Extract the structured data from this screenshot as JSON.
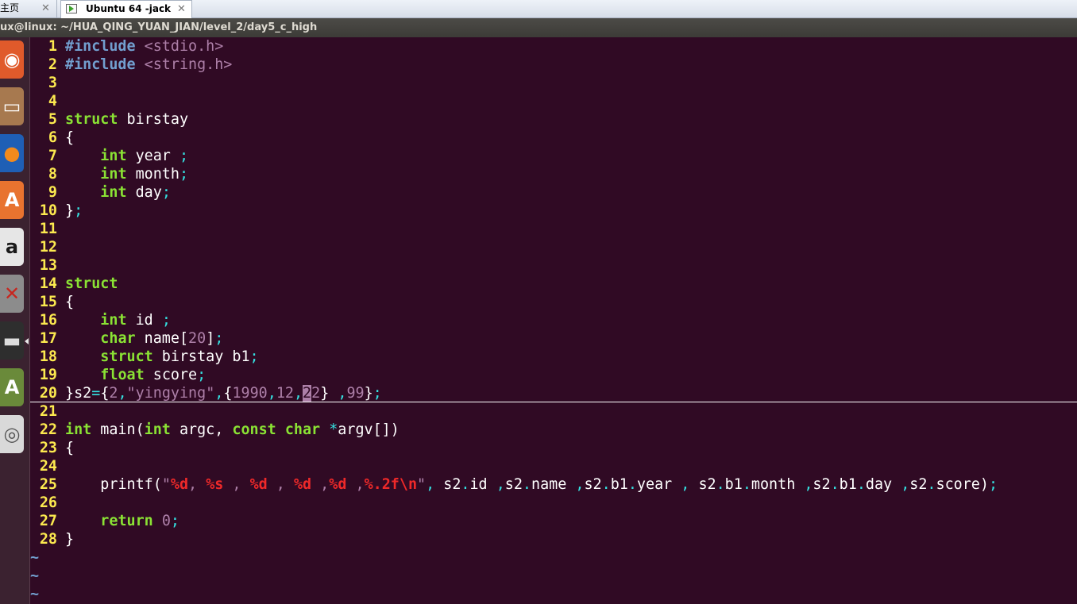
{
  "tabs": {
    "home_label": "主页",
    "vm_label": "Ubuntu 64 -jack",
    "close_glyph": "✕"
  },
  "window": {
    "title": "ux@linux: ~/HUA_QING_YUAN_JIAN/level_2/day5_c_high"
  },
  "launcher": {
    "items": [
      {
        "name": "ubuntu-dash-icon",
        "glyph": "◉",
        "bg": "#e05a2b",
        "fg": "#ffffff"
      },
      {
        "name": "files-icon",
        "glyph": "▭",
        "bg": "#a7794f",
        "fg": "#ffffff"
      },
      {
        "name": "firefox-icon",
        "glyph": "●",
        "bg": "#1f5fb5",
        "fg": "#f28a1c"
      },
      {
        "name": "software-center-icon",
        "glyph": "A",
        "bg": "#e8732f",
        "fg": "#ffffff"
      },
      {
        "name": "amazon-icon",
        "glyph": "a",
        "bg": "#e6e6e6",
        "fg": "#1a1a1a"
      },
      {
        "name": "system-settings-icon",
        "glyph": "✕",
        "bg": "#8c8c8c",
        "fg": "#c7261f"
      },
      {
        "name": "terminal-icon",
        "glyph": "▬",
        "bg": "#2e2e2e",
        "fg": "#dddddd"
      },
      {
        "name": "software-updater-icon",
        "glyph": "A",
        "bg": "#6a8a3a",
        "fg": "#ffffff"
      },
      {
        "name": "dvd-icon",
        "glyph": "◎",
        "bg": "#d9d9d9",
        "fg": "#555555"
      }
    ]
  },
  "editor": {
    "line_numbers": [
      "1",
      "2",
      "3",
      "4",
      "5",
      "6",
      "7",
      "8",
      "9",
      "10",
      "11",
      "12",
      "13",
      "14",
      "15",
      "16",
      "17",
      "18",
      "19",
      "20",
      "21",
      "22",
      "23",
      "24",
      "25",
      "26",
      "27",
      "28"
    ],
    "tilde": "~",
    "tokens": {
      "include": "#include",
      "stdio_h": "<stdio.h>",
      "string_h": "<string.h>",
      "struct": "struct",
      "birstay": " birstay",
      "lbrace": "{",
      "rbrace": "}",
      "indent": "    ",
      "int": "int",
      "year": " year ",
      "month": " month",
      "day": " day",
      "semi": ";",
      "id_decl": " id ",
      "char": "char",
      "name_decl": " name[",
      "n20": "20",
      "close_bracket": "]",
      "birstay_b1": " birstay b1",
      "float": "float",
      "score_decl": " score",
      "s2": "s2",
      "eq": "=",
      "n2": "2",
      "comma": ",",
      "yingying": "\"yingying\"",
      "n1990": "1990",
      "n12": "12",
      "n22_a": "2",
      "n22_b": "2",
      "space_comma": " ,",
      "n99": "99",
      "main": " main(",
      "argc": " argc, ",
      "const": "const",
      "argv_sp": " ",
      "star": "*",
      "argv": "argv[])",
      "printf_open": "printf(",
      "q": "\"",
      "fmt_d1": "%d",
      "f1": ", ",
      "fmt_s": "%s",
      "f2": " , ",
      "fmt_d2": "%d",
      "f3": " , ",
      "fmt_d3": "%d",
      "f4": " ,",
      "fmt_d4": "%d",
      "f5": " ,",
      "fmt_f": "%.2f\\n",
      "args_a": " s2",
      "dot": ".",
      "id": "id ",
      "s2_b": "s2",
      "name": "name ",
      "b1": "b1",
      "year2": "year ",
      "sp_s2": " s2",
      "month2": "month ",
      "day2": "day ",
      "score2": "score)",
      "return": "return",
      "n0": "0",
      "sp": " "
    }
  }
}
